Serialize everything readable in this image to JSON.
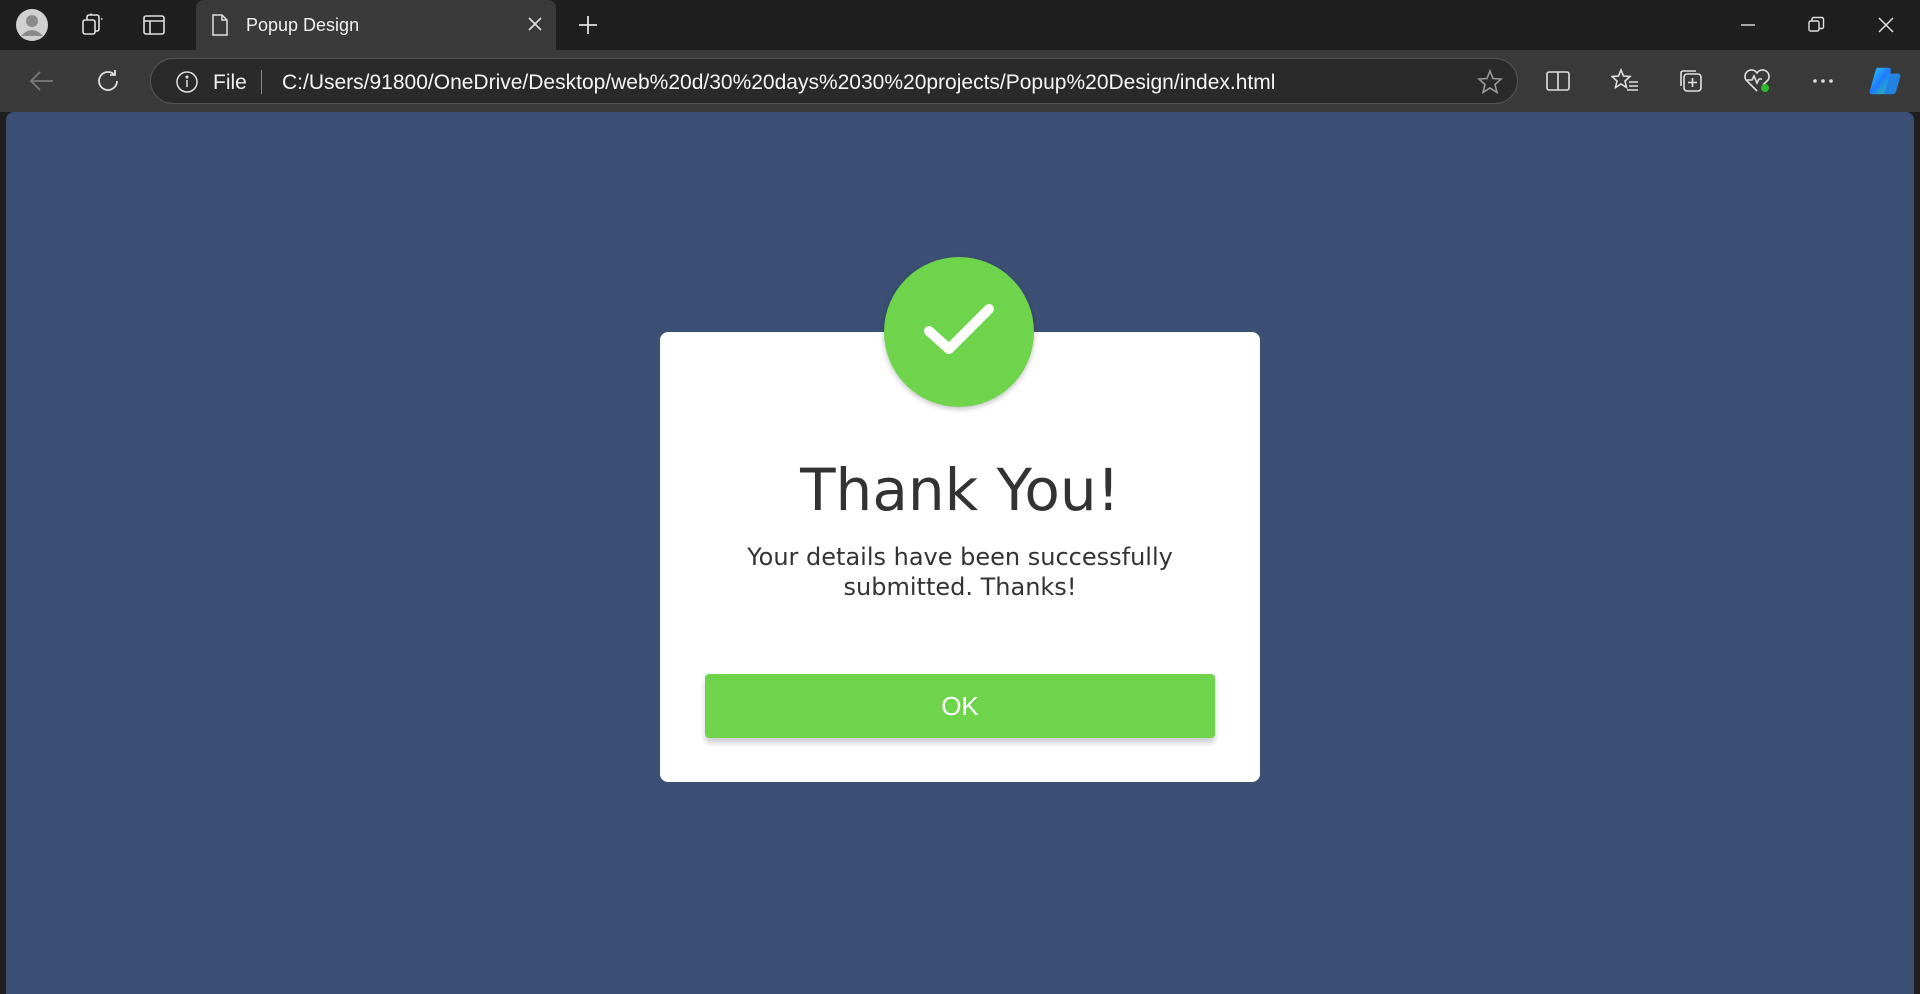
{
  "browser": {
    "tab": {
      "title": "Popup Design"
    },
    "address": {
      "scheme_label": "File",
      "url": "C:/Users/91800/OneDrive/Desktop/web%20d/30%20days%2030%20projects/Popup%20Design/index.html"
    },
    "accent_colors": {
      "copilot": "#1e90ff"
    }
  },
  "page": {
    "background_color": "#3c5076",
    "popup": {
      "title": "Thank You!",
      "message": "Your details have been successfully submitted. Thanks!",
      "button_label": "OK",
      "accent_color": "#6dd44b",
      "icon": "check-icon"
    }
  }
}
